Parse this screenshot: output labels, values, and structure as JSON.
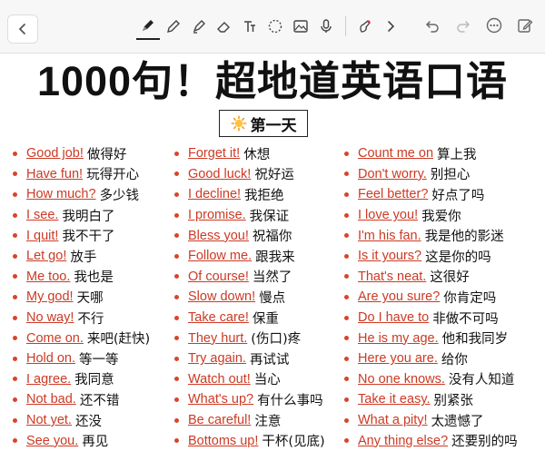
{
  "toolbar": {
    "back_icon": "chevron-left-icon",
    "tools": [
      {
        "name": "pen-icon",
        "selected": true
      },
      {
        "name": "pencil-icon",
        "selected": false
      },
      {
        "name": "highlighter-icon",
        "selected": false
      },
      {
        "name": "eraser-icon",
        "selected": false
      },
      {
        "name": "text-tool-icon",
        "selected": false
      },
      {
        "name": "lasso-icon",
        "selected": false
      },
      {
        "name": "image-icon",
        "selected": false
      },
      {
        "name": "microphone-icon",
        "selected": false
      },
      {
        "name": "hand-pen-icon",
        "selected": false
      },
      {
        "name": "chevron-right-icon",
        "selected": false
      }
    ],
    "right": [
      "undo-icon",
      "redo-icon",
      "more-icon",
      "edit-icon"
    ]
  },
  "title": "1000句！超地道英语口语",
  "day_label": "第一天",
  "accent_color": "#cc3a24",
  "columns": [
    [
      {
        "en": "Good job!",
        "zh": "做得好"
      },
      {
        "en": "Have fun!",
        "zh": "玩得开心"
      },
      {
        "en": "How much?",
        "zh": "多少钱"
      },
      {
        "en": "I see.",
        "zh": "我明白了"
      },
      {
        "en": "I quit!",
        "zh": "我不干了"
      },
      {
        "en": "Let go!",
        "zh": "放手"
      },
      {
        "en": "Me too.",
        "zh": "我也是"
      },
      {
        "en": "My god!",
        "zh": "天哪"
      },
      {
        "en": "No way!",
        "zh": "不行"
      },
      {
        "en": "Come on.",
        "zh": "来吧(赶快)"
      },
      {
        "en": "Hold on.",
        "zh": "等一等"
      },
      {
        "en": "I agree.",
        "zh": "我同意"
      },
      {
        "en": "Not bad.",
        "zh": "还不错"
      },
      {
        "en": "Not yet.",
        "zh": "还没"
      },
      {
        "en": "See you.",
        "zh": "再见"
      }
    ],
    [
      {
        "en": "Forget it!",
        "zh": "休想"
      },
      {
        "en": "Good luck!",
        "zh": "祝好运"
      },
      {
        "en": "I decline!",
        "zh": "我拒绝"
      },
      {
        "en": "I promise.",
        "zh": "我保证"
      },
      {
        "en": "Bless you!",
        "zh": "祝福你"
      },
      {
        "en": "Follow me.",
        "zh": "跟我来"
      },
      {
        "en": "Of course!",
        "zh": "当然了"
      },
      {
        "en": "Slow down!",
        "zh": "慢点"
      },
      {
        "en": "Take care!",
        "zh": "保重"
      },
      {
        "en": "They hurt.",
        "zh": "(伤口)疼"
      },
      {
        "en": "Try again.",
        "zh": "再试试"
      },
      {
        "en": "Watch out!",
        "zh": "当心"
      },
      {
        "en": "What's up?",
        "zh": "有什么事吗"
      },
      {
        "en": "Be careful!",
        "zh": "注意"
      },
      {
        "en": "Bottoms up!",
        "zh": "干杯(见底)"
      }
    ],
    [
      {
        "en": "Count me on",
        "zh": "算上我"
      },
      {
        "en": "Don't worry.",
        "zh": "别担心"
      },
      {
        "en": "Feel better?",
        "zh": "好点了吗"
      },
      {
        "en": "I love you!",
        "zh": "我爱你"
      },
      {
        "en": "I'm his fan.",
        "zh": "我是他的影迷"
      },
      {
        "en": "Is it yours?",
        "zh": "这是你的吗"
      },
      {
        "en": "That's neat.",
        "zh": "这很好"
      },
      {
        "en": "Are you sure?",
        "zh": "你肯定吗"
      },
      {
        "en": "Do I have to",
        "zh": "非做不可吗"
      },
      {
        "en": "He is my age.",
        "zh": "他和我同岁"
      },
      {
        "en": "Here you are.",
        "zh": "给你"
      },
      {
        "en": "No one knows.",
        "zh": "没有人知道"
      },
      {
        "en": "Take it easy.",
        "zh": "别紧张"
      },
      {
        "en": "What a pity!",
        "zh": "太遗憾了"
      },
      {
        "en": "Any thing else?",
        "zh": "还要别的吗"
      }
    ]
  ]
}
